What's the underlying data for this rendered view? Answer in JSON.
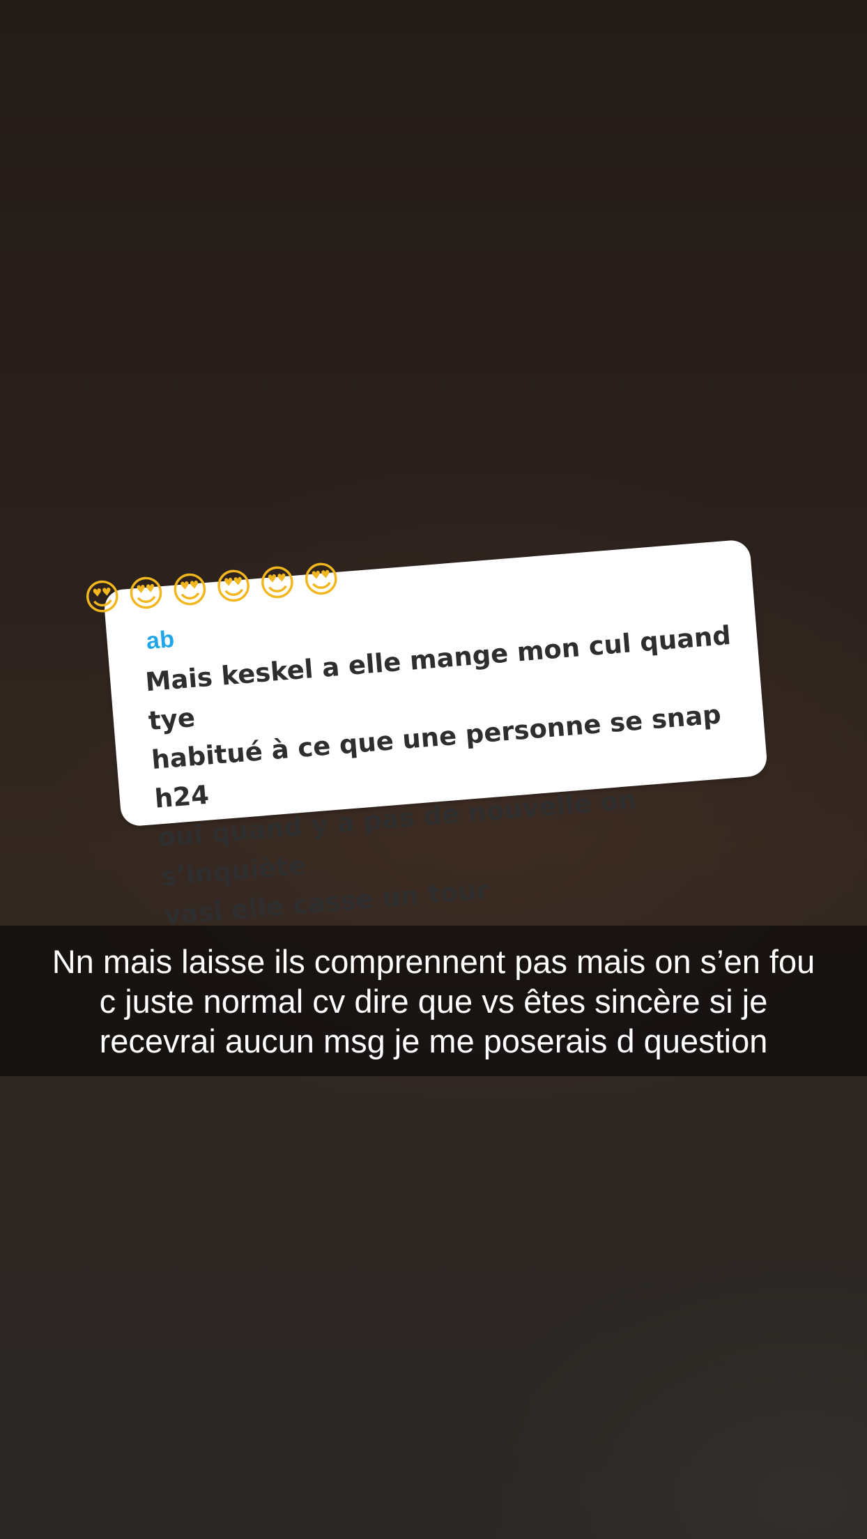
{
  "reply_card": {
    "name": "ab",
    "message": "Mais keskel a elle mange mon cul quand tye\nhabitué à ce que une personne se snap h24\noui quand y a pas de nouvelle on s’inquiète\nvasi elle casse un tour"
  },
  "emojis": [
    "smiling-face-with-heart-eyes",
    "smiling-face-with-heart-eyes",
    "smiling-face-with-heart-eyes",
    "smiling-face-with-heart-eyes",
    "smiling-face-with-heart-eyes",
    "smiling-face-with-heart-eyes"
  ],
  "caption": {
    "text": "Nn mais laisse ils comprennent pas mais on s’en fou\nc juste normal cv dire que vs êtes sincère si je\nrecevrai aucun msg je me poserais d question"
  }
}
